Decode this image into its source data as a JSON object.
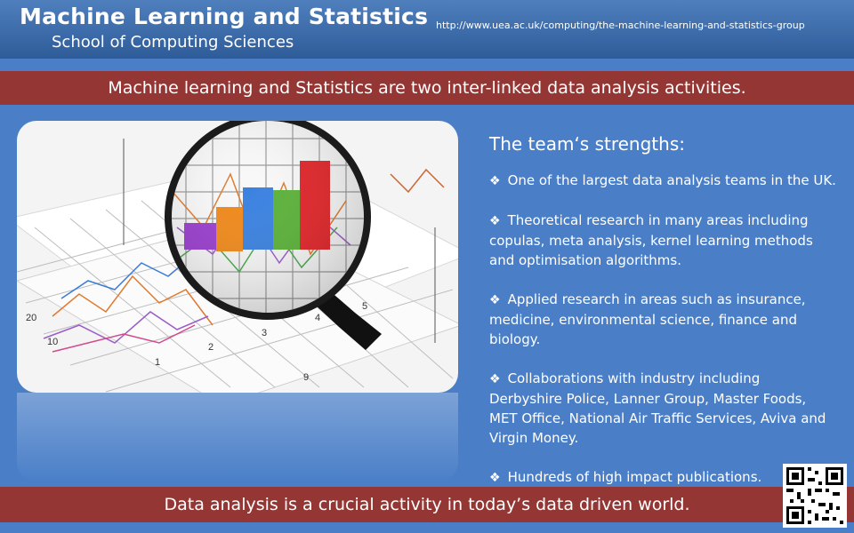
{
  "header": {
    "title": "Machine Learning and Statistics",
    "subtitle": "School of Computing Sciences",
    "url": "http://www.uea.ac.uk/computing/the-machine-learning-and-statistics-group"
  },
  "tagline": "Machine learning and Statistics are two inter-linked data analysis activities.",
  "strengths": {
    "heading": "The  team‘s strengths:",
    "bullet_glyph": "❖",
    "items": [
      "One of the largest  data analysis teams in the UK.",
      "Theoretical research in  many areas including copulas,  meta analysis,  kernel learning methods and optimisation algorithms.",
      "Applied research in areas such as insurance, medicine, environmental science, finance and biology.",
      "Collaborations with industry including Derbyshire Police, Lanner Group, Master Foods, MET Office, National Air Traffic Services, Aviva and Virgin Money.",
      "Hundreds of  high  impact publications."
    ]
  },
  "footer": "Data analysis is a crucial activity in today’s data driven world.",
  "image": {
    "subject": "magnifying-glass-over-bar-chart",
    "graph_numbers": [
      "20",
      "10",
      "1",
      "2",
      "3",
      "4",
      "5",
      "9"
    ]
  },
  "colors": {
    "background": "#4a7fc8",
    "header": "#2e5c99",
    "band": "#943634",
    "text": "#ffffff"
  }
}
